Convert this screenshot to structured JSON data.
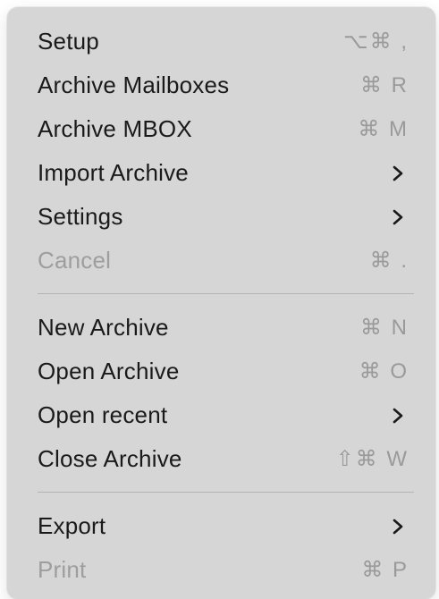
{
  "menu": {
    "items": [
      {
        "label": "Setup",
        "shortcut": "⌥⌘ ,"
      },
      {
        "label": "Archive Mailboxes",
        "shortcut": "⌘ R"
      },
      {
        "label": "Archive MBOX",
        "shortcut": "⌘ M"
      },
      {
        "label": "Import Archive",
        "submenu_icon": "chevron-right-icon"
      },
      {
        "label": "Settings",
        "submenu_icon": "chevron-right-icon"
      },
      {
        "label": "Cancel",
        "shortcut": "⌘ .",
        "disabled": true
      },
      {
        "label": "New Archive",
        "shortcut": "⌘ N"
      },
      {
        "label": "Open Archive",
        "shortcut": "⌘ O"
      },
      {
        "label": "Open recent",
        "submenu_icon": "chevron-right-icon"
      },
      {
        "label": "Close Archive",
        "shortcut": "⇧⌘ W"
      },
      {
        "label": "Export",
        "submenu_icon": "chevron-right-icon"
      },
      {
        "label": "Print",
        "shortcut": "⌘ P",
        "disabled": true
      }
    ]
  },
  "colors": {
    "menu_background": "#d6d6d6",
    "label_text": "#1a1a1a",
    "disabled_text": "#9e9e9e",
    "shortcut_text": "#9a9a9a",
    "separator": "#b4b4b4"
  }
}
